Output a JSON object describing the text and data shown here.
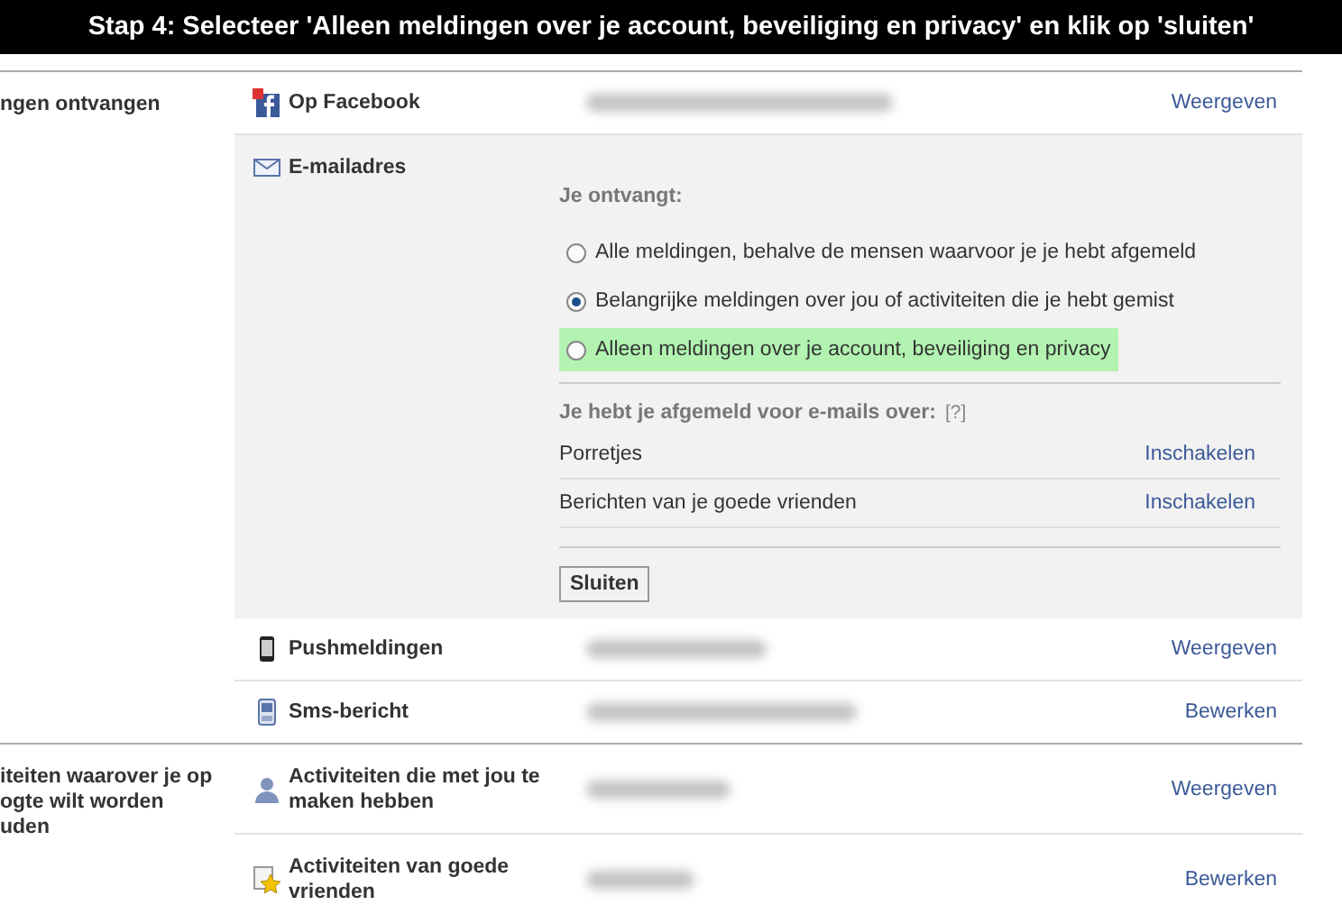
{
  "banner": {
    "text": "Stap 4: Selecteer 'Alleen meldingen over je account, beveiliging en privacy' en klik op 'sluiten'"
  },
  "sections": [
    {
      "label": "ngen ontvangen",
      "channels": [
        {
          "kind": "facebook",
          "label": "Op Facebook",
          "action": "Weergeven",
          "expanded": false
        },
        {
          "kind": "mail",
          "label": "E-mailadres",
          "expanded": true,
          "panel": {
            "heading": "Je ontvangt:",
            "options": [
              {
                "label": "Alle meldingen, behalve de mensen waarvoor je je hebt afgemeld",
                "selected": false,
                "highlighted": false
              },
              {
                "label": "Belangrijke meldingen over jou of activiteiten die je hebt gemist",
                "selected": true,
                "highlighted": false
              },
              {
                "label": "Alleen meldingen over je account, beveiliging en privacy",
                "selected": false,
                "highlighted": true
              }
            ],
            "unsubscribed_heading": "Je hebt je afgemeld voor e-mails over:",
            "help": "[?]",
            "unsubscribed": [
              {
                "label": "Porretjes",
                "action": "Inschakelen"
              },
              {
                "label": "Berichten van je goede vrienden",
                "action": "Inschakelen"
              }
            ],
            "close_button": "Sluiten"
          }
        },
        {
          "kind": "phone",
          "label": "Pushmeldingen",
          "action": "Weergeven",
          "expanded": false
        },
        {
          "kind": "mobile",
          "label": "Sms-bericht",
          "action": "Bewerken",
          "expanded": false
        }
      ]
    },
    {
      "label": "iteiten waarover je op\nogte wilt worden\nuden",
      "channels": [
        {
          "kind": "person",
          "label": "Activiteiten die met jou te maken hebben",
          "action": "Weergeven",
          "expanded": false
        },
        {
          "kind": "star",
          "label": "Activiteiten van goede vrienden",
          "action": "Bewerken",
          "expanded": false
        }
      ]
    }
  ]
}
